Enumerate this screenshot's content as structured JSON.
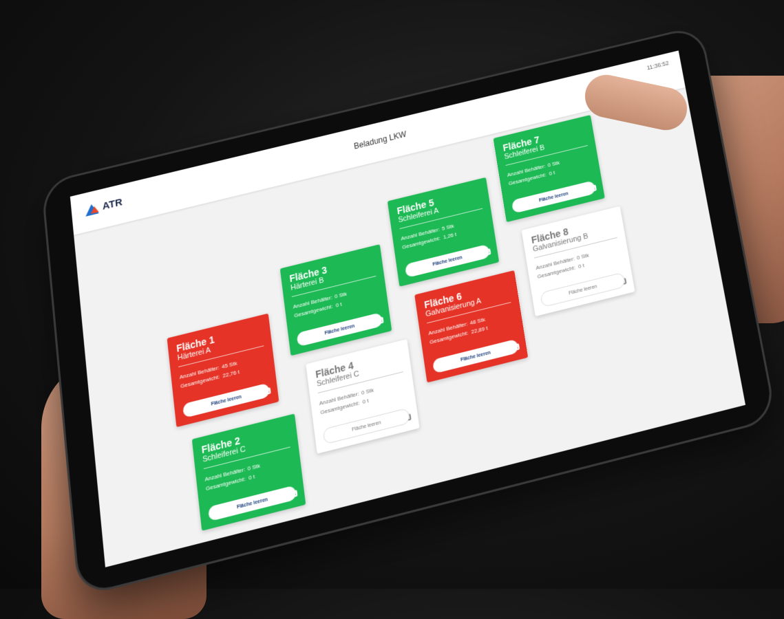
{
  "header": {
    "logo_text": "ATR",
    "page_title": "Beladung LKW",
    "clock": "11:36:52"
  },
  "cards": [
    {
      "title": "Fläche 1",
      "subtitle": "Härterei A",
      "containers_label": "Anzahl Behälter:",
      "containers_value": "45 Stk",
      "weight_label": "Gesamtgewicht:",
      "weight_value": "22,76 t",
      "button": "Fläche leeren",
      "status": "red"
    },
    {
      "title": "Fläche 2",
      "subtitle": "Schleiferei C",
      "containers_label": "Anzahl Behälter:",
      "containers_value": "0 Stk",
      "weight_label": "Gesamtgewicht:",
      "weight_value": "0 t",
      "button": "Fläche leeren",
      "status": "green"
    },
    {
      "title": "Fläche 3",
      "subtitle": "Härterei B",
      "containers_label": "Anzahl Behälter:",
      "containers_value": "0 Stk",
      "weight_label": "Gesamtgewicht:",
      "weight_value": "0 t",
      "button": "Fläche leeren",
      "status": "green"
    },
    {
      "title": "Fläche 4",
      "subtitle": "Schleiferei C",
      "containers_label": "Anzahl Behälter:",
      "containers_value": "0 Stk",
      "weight_label": "Gesamtgewicht:",
      "weight_value": "0 t",
      "button": "Fläche leeren",
      "status": "white"
    },
    {
      "title": "Fläche 5",
      "subtitle": "Schleiferei A",
      "containers_label": "Anzahl Behälter:",
      "containers_value": "5 Stk",
      "weight_label": "Gesamtgewicht:",
      "weight_value": "1,26 t",
      "button": "Fläche leeren",
      "status": "green"
    },
    {
      "title": "Fläche 6",
      "subtitle": "Galvanisierung A",
      "containers_label": "Anzahl Behälter:",
      "containers_value": "48 Stk",
      "weight_label": "Gesamtgewicht:",
      "weight_value": "22,89 t",
      "button": "Fläche leeren",
      "status": "red"
    },
    {
      "title": "Fläche 7",
      "subtitle": "Schleiferei B",
      "containers_label": "Anzahl Behälter:",
      "containers_value": "0 Stk",
      "weight_label": "Gesamtgewicht:",
      "weight_value": "0 t",
      "button": "Fläche leeren",
      "status": "green"
    },
    {
      "title": "Fläche 8",
      "subtitle": "Galvanisierung B",
      "containers_label": "Anzahl Behälter:",
      "containers_value": "0 Stk",
      "weight_label": "Gesamtgewicht:",
      "weight_value": "0 t",
      "button": "Fläche leeren",
      "status": "white"
    }
  ],
  "colors": {
    "red": "#e53327",
    "green": "#1db954",
    "white": "#ffffff"
  }
}
